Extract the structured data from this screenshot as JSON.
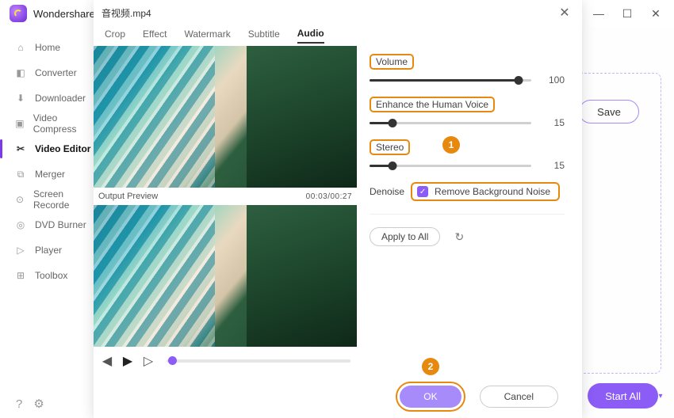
{
  "titlebar": {
    "brand": "Wondershare"
  },
  "sidebar": {
    "items": [
      {
        "label": "Home",
        "icon": "home"
      },
      {
        "label": "Converter",
        "icon": "convert"
      },
      {
        "label": "Downloader",
        "icon": "download"
      },
      {
        "label": "Video Compress",
        "icon": "compress"
      },
      {
        "label": "Video Editor",
        "icon": "scissors",
        "active": true
      },
      {
        "label": "Merger",
        "icon": "merge"
      },
      {
        "label": "Screen Recorde",
        "icon": "record"
      },
      {
        "label": "DVD Burner",
        "icon": "disc"
      },
      {
        "label": "Player",
        "icon": "play"
      },
      {
        "label": "Toolbox",
        "icon": "grid"
      }
    ]
  },
  "main": {
    "save": "Save",
    "start_all": "Start All"
  },
  "modal": {
    "title": "音视频.mp4",
    "tabs": [
      "Crop",
      "Effect",
      "Watermark",
      "Subtitle",
      "Audio"
    ],
    "active_tab": "Audio",
    "preview_label": "Output Preview",
    "timecode": "00:03/00:27",
    "controls": {
      "volume": {
        "label": "Volume",
        "value": 100,
        "pct": 92
      },
      "enhance": {
        "label": "Enhance the Human Voice",
        "value": 15,
        "pct": 14
      },
      "stereo": {
        "label": "Stereo",
        "value": 15,
        "pct": 14
      },
      "denoise_label": "Denoise",
      "remove_noise": {
        "label": "Remove Background Noise",
        "checked": true
      }
    },
    "apply_all": "Apply to All",
    "ok": "OK",
    "cancel": "Cancel"
  },
  "annotations": {
    "b1": "1",
    "b2": "2"
  }
}
